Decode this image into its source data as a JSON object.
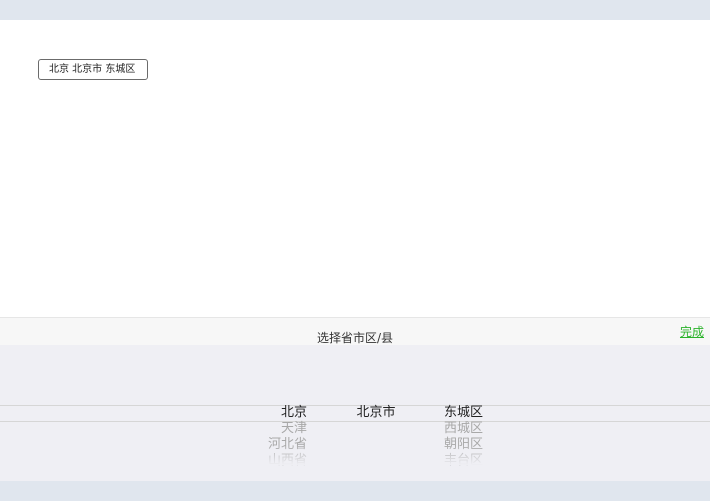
{
  "city_input": {
    "value": "北京 北京市 东城区"
  },
  "picker": {
    "title": "选择省市区/县",
    "done_label": "完成",
    "provinces": [
      "北京",
      "天津",
      "河北省",
      "山西省"
    ],
    "cities": [
      "北京市"
    ],
    "districts": [
      "东城区",
      "西城区",
      "朝阳区",
      "丰台区"
    ],
    "selected": {
      "province": "北京",
      "city": "北京市",
      "district": "东城区"
    }
  },
  "colors": {
    "accent": "#2bb32b",
    "picker_bg": "#efeff4",
    "bar_bg": "#e0e6ee"
  }
}
